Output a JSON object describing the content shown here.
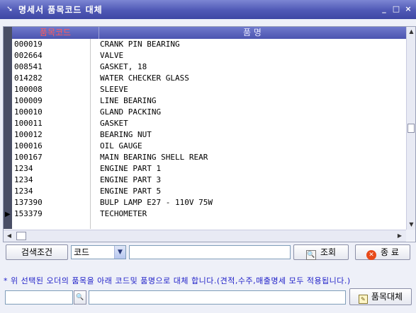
{
  "window": {
    "title": "명세서 품목코드 대체",
    "icon": "arrow-icon",
    "controls": {
      "minimize": "_",
      "maximize": "□",
      "close": "×"
    }
  },
  "grid": {
    "columns": {
      "code": "품목코드",
      "name": "품 명"
    },
    "rows": [
      {
        "code": "000019",
        "name": "CRANK PIN BEARING"
      },
      {
        "code": "002664",
        "name": "VALVE"
      },
      {
        "code": "008541",
        "name": "GASKET, 18"
      },
      {
        "code": "014282",
        "name": "WATER CHECKER GLASS"
      },
      {
        "code": "100008",
        "name": "SLEEVE"
      },
      {
        "code": "100009",
        "name": "LINE BEARING"
      },
      {
        "code": "100010",
        "name": "GLAND PACKING"
      },
      {
        "code": "100011",
        "name": "GASKET"
      },
      {
        "code": "100012",
        "name": "BEARING NUT"
      },
      {
        "code": "100016",
        "name": "OIL GAUGE"
      },
      {
        "code": "100167",
        "name": "MAIN BEARING SHELL REAR"
      },
      {
        "code": "1234",
        "name": "ENGINE PART 1"
      },
      {
        "code": "1234",
        "name": "ENGINE PART 3"
      },
      {
        "code": "1234",
        "name": "ENGINE PART 5"
      },
      {
        "code": "137390",
        "name": "BULP LAMP E27 - 110V 75W"
      },
      {
        "code": "153379",
        "name": "TECHOMETER"
      }
    ],
    "current_row_index": 15
  },
  "search": {
    "condition_label": "검색조건",
    "field_selected": "코드",
    "value": "",
    "search_button": "조회",
    "close_button": "종 료"
  },
  "replace": {
    "notice": "* 위 선택된 오더의 품목을 아래 코드및 품명으로 대체 합니다.(견적,수주,매출명세 모두 적용됩니다.)",
    "code_value": "",
    "name_value": "",
    "button": "품목대체"
  }
}
